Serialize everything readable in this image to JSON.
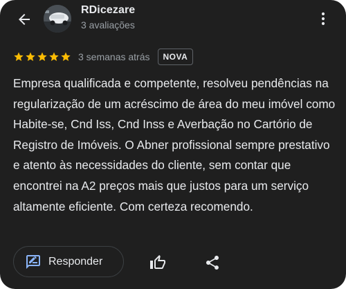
{
  "author": {
    "name": "RDicezare",
    "meta": "3 avaliações"
  },
  "review": {
    "stars": 5,
    "max_stars": 5,
    "date": "3 semanas atrás",
    "badge": "NOVA",
    "text": "Empresa qualificada e competente, resolveu pendências na regularização de um acréscimo de área do meu imóvel como Habite-se, Cnd Iss, Cnd Inss e Averbação no Cartório de Registro de Imóveis. O Abner profissional sempre prestativo e atento às necessidades do cliente, sem contar que encontrei na A2 preços mais que justos para um serviço altamente eficiente. Com certeza recomendo."
  },
  "actions": {
    "reply_label": "Responder"
  },
  "icons": {
    "back": "arrow-back-icon",
    "menu": "more-vert-icon",
    "star": "star-icon",
    "reply": "rate-review-icon",
    "like": "thumb-up-icon",
    "share": "share-icon"
  },
  "colors": {
    "card_background": "#1f1f1f",
    "star": "#fbbc04",
    "primary_text": "#e8eaed",
    "secondary_text": "#9aa0a6",
    "accent": "#8ab4f8"
  }
}
